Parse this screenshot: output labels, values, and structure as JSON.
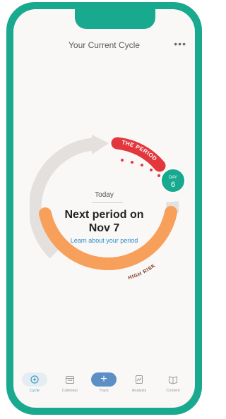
{
  "header": {
    "title": "Your Current Cycle",
    "more_icon": "more-dots-icon"
  },
  "ring": {
    "period_label": "THE PERIOD",
    "risk_label": "HIGH RISK",
    "day_label": "DAY",
    "day_number": "6",
    "colors": {
      "period": "#e2373d",
      "risk": "#f7a05c",
      "track": "#e3e0dd",
      "day_badge": "#18a98f"
    }
  },
  "center": {
    "today_label": "Today",
    "next_period_line1": "Next period on",
    "next_period_line2": "Nov 7",
    "learn_link": "Learn about your period"
  },
  "nav": {
    "items": [
      {
        "label": "Cycle",
        "icon": "cycle-icon",
        "active": true
      },
      {
        "label": "Calendar",
        "icon": "calendar-icon",
        "active": false
      },
      {
        "label": "Track",
        "icon": "plus-icon",
        "active": false
      },
      {
        "label": "Analysis",
        "icon": "analysis-icon",
        "active": false
      },
      {
        "label": "Content",
        "icon": "book-icon",
        "active": false
      }
    ]
  }
}
